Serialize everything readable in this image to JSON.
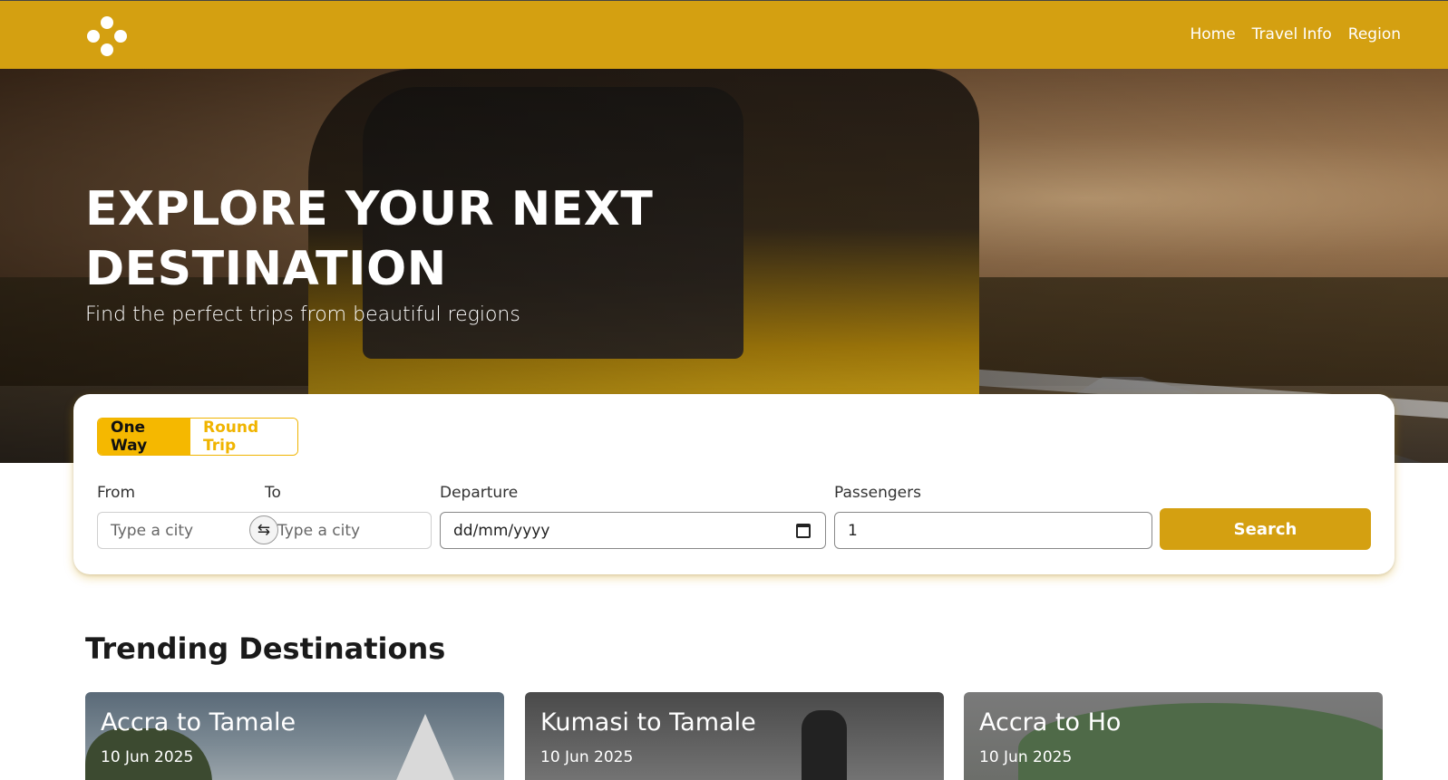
{
  "nav": {
    "logo_icon": "four-dots-logo-icon",
    "links": [
      "Home",
      "Travel Info",
      "Region"
    ]
  },
  "hero": {
    "title": "EXPLORE YOUR NEXT DESTINATION",
    "subtitle": "Find the perfect trips from beautiful regions"
  },
  "search": {
    "tabs": [
      {
        "label": "One Way",
        "active": true
      },
      {
        "label": "Round Trip",
        "active": false
      }
    ],
    "from": {
      "label": "From",
      "placeholder": "Type a city"
    },
    "to": {
      "label": "To",
      "placeholder": "Type a city"
    },
    "swap_icon": "swap-arrows-icon",
    "departure": {
      "label": "Departure",
      "placeholder": "dd/mm/yyyy"
    },
    "passengers": {
      "label": "Passengers",
      "value": "1"
    },
    "button": "Search"
  },
  "trending": {
    "title": "Trending Destinations",
    "items": [
      {
        "route": "Accra to Tamale",
        "date": "10 Jun 2025"
      },
      {
        "route": "Kumasi to Tamale",
        "date": "10 Jun 2025"
      },
      {
        "route": "Accra to Ho",
        "date": "10 Jun 2025"
      }
    ]
  },
  "colors": {
    "brand": "#d4a011",
    "tab_active": "#f5b800"
  }
}
